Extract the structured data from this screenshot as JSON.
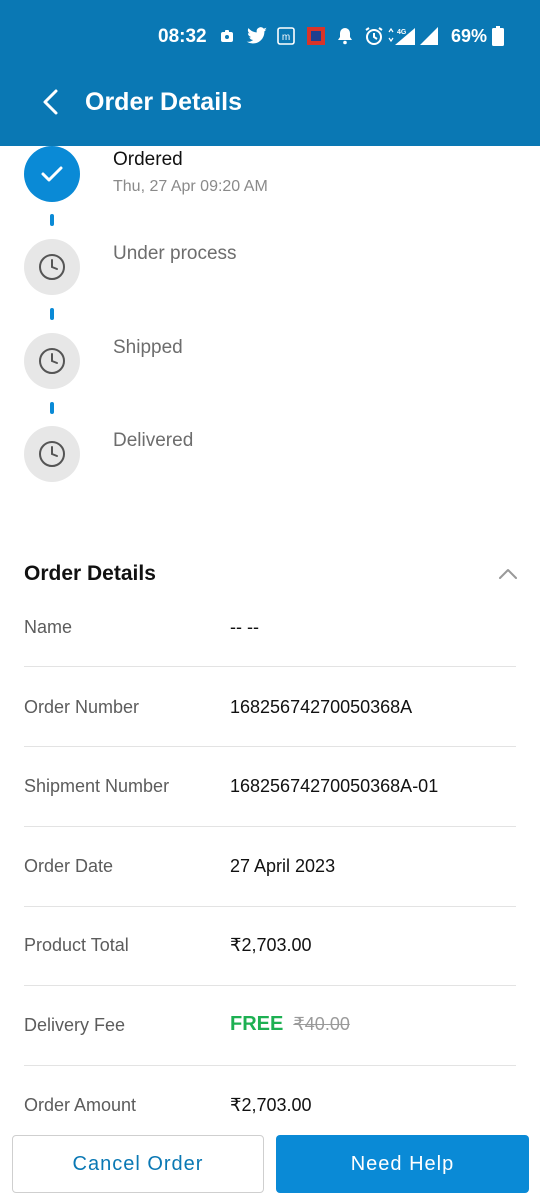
{
  "status_bar": {
    "time": "08:32",
    "battery": "69%",
    "network": "4G"
  },
  "app_bar": {
    "title": "Order Details"
  },
  "timeline": {
    "steps": [
      {
        "label": "Ordered",
        "date": "Thu, 27 Apr 09:20 AM",
        "state": "done"
      },
      {
        "label": "Under process",
        "state": "pending"
      },
      {
        "label": "Shipped",
        "state": "pending"
      },
      {
        "label": "Delivered",
        "state": "pending"
      }
    ]
  },
  "details": {
    "heading": "Order Details",
    "rows": [
      {
        "label": "Name",
        "value": "-- --"
      },
      {
        "label": "Order Number",
        "value": "16825674270050368A"
      },
      {
        "label": "Shipment Number",
        "value": "16825674270050368A-01"
      },
      {
        "label": "Order Date",
        "value": "27 April 2023"
      },
      {
        "label": "Product Total",
        "value": "₹2,703.00"
      },
      {
        "label": "Delivery Fee",
        "value": "FREE",
        "strike": "₹40.00"
      },
      {
        "label": "Order Amount",
        "value": "₹2,703.00"
      }
    ]
  },
  "buttons": {
    "cancel": "Cancel Order",
    "help": "Need Help"
  },
  "colors": {
    "brand": "#0a78b4",
    "accent": "#0a8ad6",
    "free": "#1db052"
  }
}
